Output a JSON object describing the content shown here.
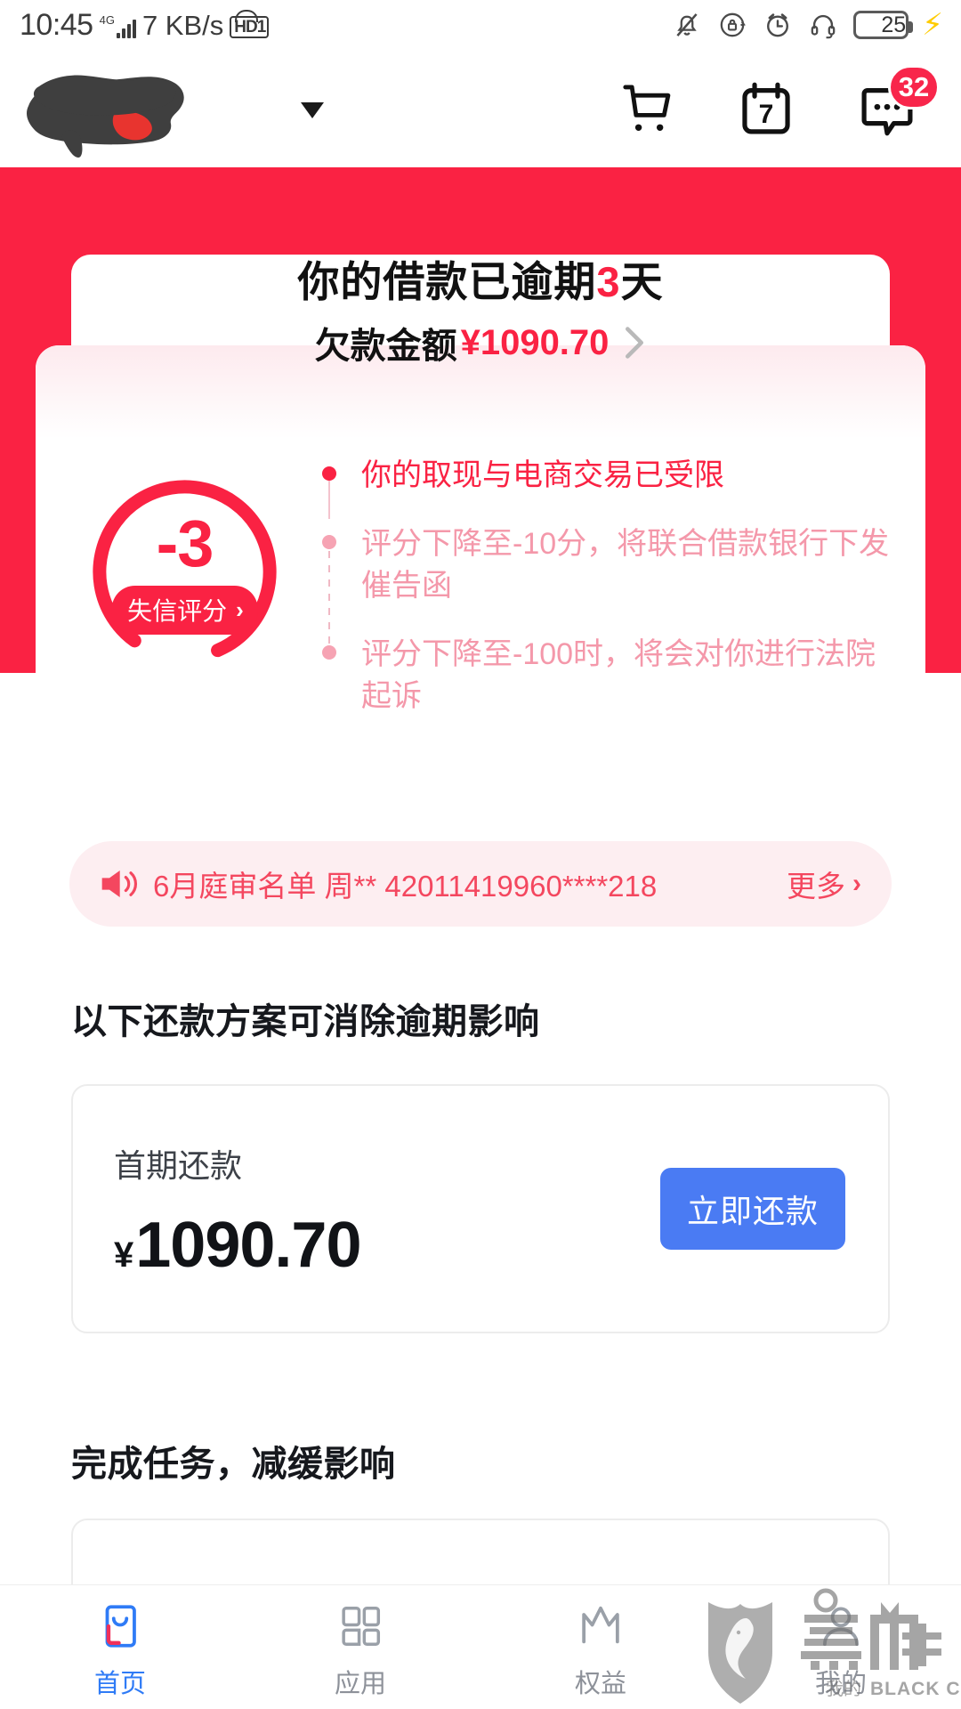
{
  "statusbar": {
    "time": "10:45",
    "network_type": "4G",
    "network_prefix": "4↑",
    "data_speed": "7 KB/s",
    "hd_label": "HD",
    "hd_sim": "1",
    "battery_percent": "25",
    "icons": [
      "bell-muted-icon",
      "rotation-lock-icon",
      "alarm-clock-icon",
      "headphones-icon",
      "battery-icon",
      "charging-bolt-icon"
    ]
  },
  "header": {
    "logo_alt": "redacted-logo",
    "dropdown_icon": "caret-down-icon",
    "cart_icon": "shopping-cart-icon",
    "calendar_icon": "calendar-icon",
    "calendar_day": "7",
    "message_icon": "message-bubble-icon",
    "message_badge": "32"
  },
  "hero": {
    "title_prefix": "你的借款已逾期",
    "title_days": "3",
    "title_suffix": "天",
    "amount_label": "欠款金额",
    "amount_value": "¥1090.70",
    "chevron_icon": "chevron-right-icon"
  },
  "score": {
    "value": "-3",
    "pill_label": "失信评分",
    "pill_chevron": "›",
    "gauge_color": "#fa2243",
    "bullets": [
      {
        "text": "你的取现与电商交易已受限",
        "emphasis": "high"
      },
      {
        "text": "评分下降至-10分，将联合借款银行下发催告函",
        "emphasis": "low"
      },
      {
        "text": "评分下降至-100时，将会对你进行法院起诉",
        "emphasis": "low"
      }
    ]
  },
  "notice": {
    "speaker_icon": "speaker-icon",
    "text": "6月庭审名单 周** 42011419960****218",
    "more_label": "更多",
    "more_chevron": "›"
  },
  "repay_section": {
    "heading": "以下还款方案可消除逾期影响",
    "card": {
      "label": "首期还款",
      "currency": "¥",
      "amount": "1090.70",
      "button_label": "立即还款"
    }
  },
  "task_section": {
    "heading": "完成任务，减缓影响"
  },
  "tabbar": {
    "items": [
      {
        "label": "首页",
        "icon": "home-icon",
        "active": true
      },
      {
        "label": "应用",
        "icon": "apps-grid-icon",
        "active": false
      },
      {
        "label": "权益",
        "icon": "crown-icon",
        "active": false
      },
      {
        "label": "我的",
        "icon": "profile-icon",
        "active": false
      }
    ]
  },
  "watermark": {
    "brand_cn": "黑猫",
    "brand_en": "BLACK CAT",
    "sub_cn": "我的",
    "icon": "black-cat-shield-icon"
  },
  "colors": {
    "brand_red": "#fa2243",
    "accent_blue": "#4a7bf3",
    "tab_active": "#2f7bf6",
    "notice_bg": "#fdeef1",
    "muted_pink": "#f498aa"
  }
}
